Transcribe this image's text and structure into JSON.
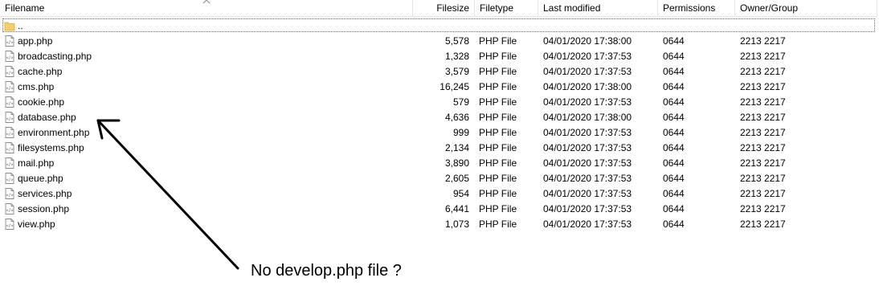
{
  "columns": {
    "filename": "Filename",
    "filesize": "Filesize",
    "filetype": "Filetype",
    "last_modified": "Last modified",
    "permissions": "Permissions",
    "owner_group": "Owner/Group"
  },
  "parent_entry": {
    "name": ".."
  },
  "files": [
    {
      "name": "app.php",
      "size": "5,578",
      "type": "PHP File",
      "modified": "04/01/2020 17:38:00",
      "perm": "0644",
      "owner": "2213 2217"
    },
    {
      "name": "broadcasting.php",
      "size": "1,328",
      "type": "PHP File",
      "modified": "04/01/2020 17:37:53",
      "perm": "0644",
      "owner": "2213 2217"
    },
    {
      "name": "cache.php",
      "size": "3,579",
      "type": "PHP File",
      "modified": "04/01/2020 17:37:53",
      "perm": "0644",
      "owner": "2213 2217"
    },
    {
      "name": "cms.php",
      "size": "16,245",
      "type": "PHP File",
      "modified": "04/01/2020 17:38:00",
      "perm": "0644",
      "owner": "2213 2217"
    },
    {
      "name": "cookie.php",
      "size": "579",
      "type": "PHP File",
      "modified": "04/01/2020 17:37:53",
      "perm": "0644",
      "owner": "2213 2217"
    },
    {
      "name": "database.php",
      "size": "4,636",
      "type": "PHP File",
      "modified": "04/01/2020 17:38:00",
      "perm": "0644",
      "owner": "2213 2217"
    },
    {
      "name": "environment.php",
      "size": "999",
      "type": "PHP File",
      "modified": "04/01/2020 17:37:53",
      "perm": "0644",
      "owner": "2213 2217"
    },
    {
      "name": "filesystems.php",
      "size": "2,134",
      "type": "PHP File",
      "modified": "04/01/2020 17:37:53",
      "perm": "0644",
      "owner": "2213 2217"
    },
    {
      "name": "mail.php",
      "size": "3,890",
      "type": "PHP File",
      "modified": "04/01/2020 17:37:53",
      "perm": "0644",
      "owner": "2213 2217"
    },
    {
      "name": "queue.php",
      "size": "2,605",
      "type": "PHP File",
      "modified": "04/01/2020 17:37:53",
      "perm": "0644",
      "owner": "2213 2217"
    },
    {
      "name": "services.php",
      "size": "954",
      "type": "PHP File",
      "modified": "04/01/2020 17:37:53",
      "perm": "0644",
      "owner": "2213 2217"
    },
    {
      "name": "session.php",
      "size": "6,441",
      "type": "PHP File",
      "modified": "04/01/2020 17:37:53",
      "perm": "0644",
      "owner": "2213 2217"
    },
    {
      "name": "view.php",
      "size": "1,073",
      "type": "PHP File",
      "modified": "04/01/2020 17:37:53",
      "perm": "0644",
      "owner": "2213 2217"
    }
  ],
  "annotation": {
    "text": "No develop.php file ?"
  },
  "icons": {
    "parent": "folder-icon",
    "file": "php-file-icon",
    "sort": "sort-caret-icon"
  },
  "colors": {
    "folder": "#f5cf6b",
    "grid_line": "#e5e5e5"
  }
}
